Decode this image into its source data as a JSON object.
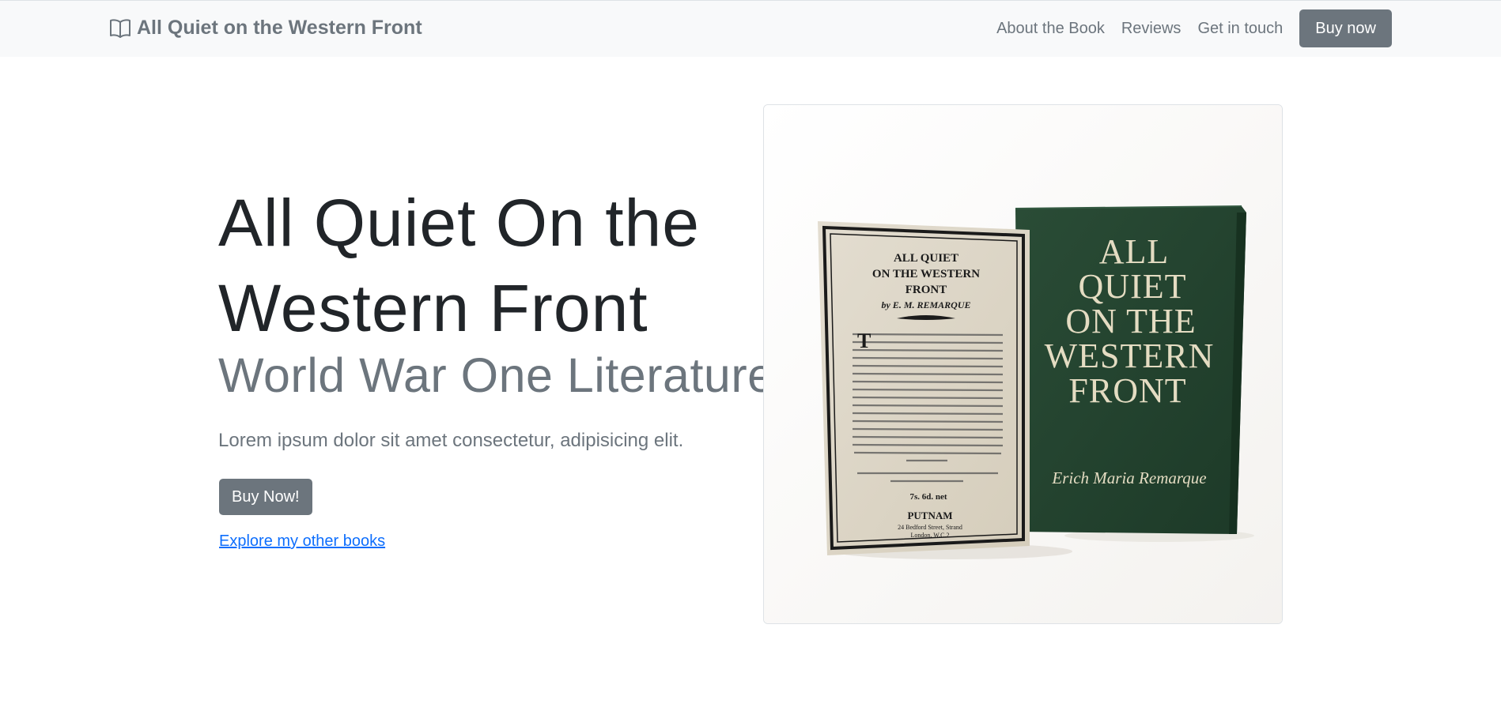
{
  "navbar": {
    "brand_icon": "book-open-icon",
    "brand": "All Quiet on the Western Front",
    "links": [
      "About the Book",
      "Reviews",
      "Get in touch"
    ],
    "cta": "Buy now"
  },
  "hero": {
    "title": "All Quiet On the Western Front",
    "subtitle": "World War One Literature",
    "lead": "Lorem ipsum dolor sit amet consectetur, adipisicing elit.",
    "button": "Buy Now!",
    "link": "Explore my other books"
  },
  "book_image": {
    "insert": {
      "title_lines": [
        "ALL QUIET",
        "ON THE WESTERN",
        "FRONT"
      ],
      "byline": "by E. M. REMARQUE",
      "price": "7s. 6d. net",
      "publisher": "PUTNAM",
      "address_lines": [
        "24 Bedford Street, Strand",
        "London, W.C.2"
      ]
    },
    "cover": {
      "title_lines": [
        "ALL",
        "QUIET",
        "ON THE",
        "WESTERN",
        "FRONT"
      ],
      "author": "Erich Maria Remarque"
    }
  },
  "colors": {
    "navbar_bg": "#f8f9fa",
    "muted": "#6c757d",
    "link": "#0d6efd",
    "cover_green": "#23432f",
    "cover_text": "#e4dcc2"
  }
}
